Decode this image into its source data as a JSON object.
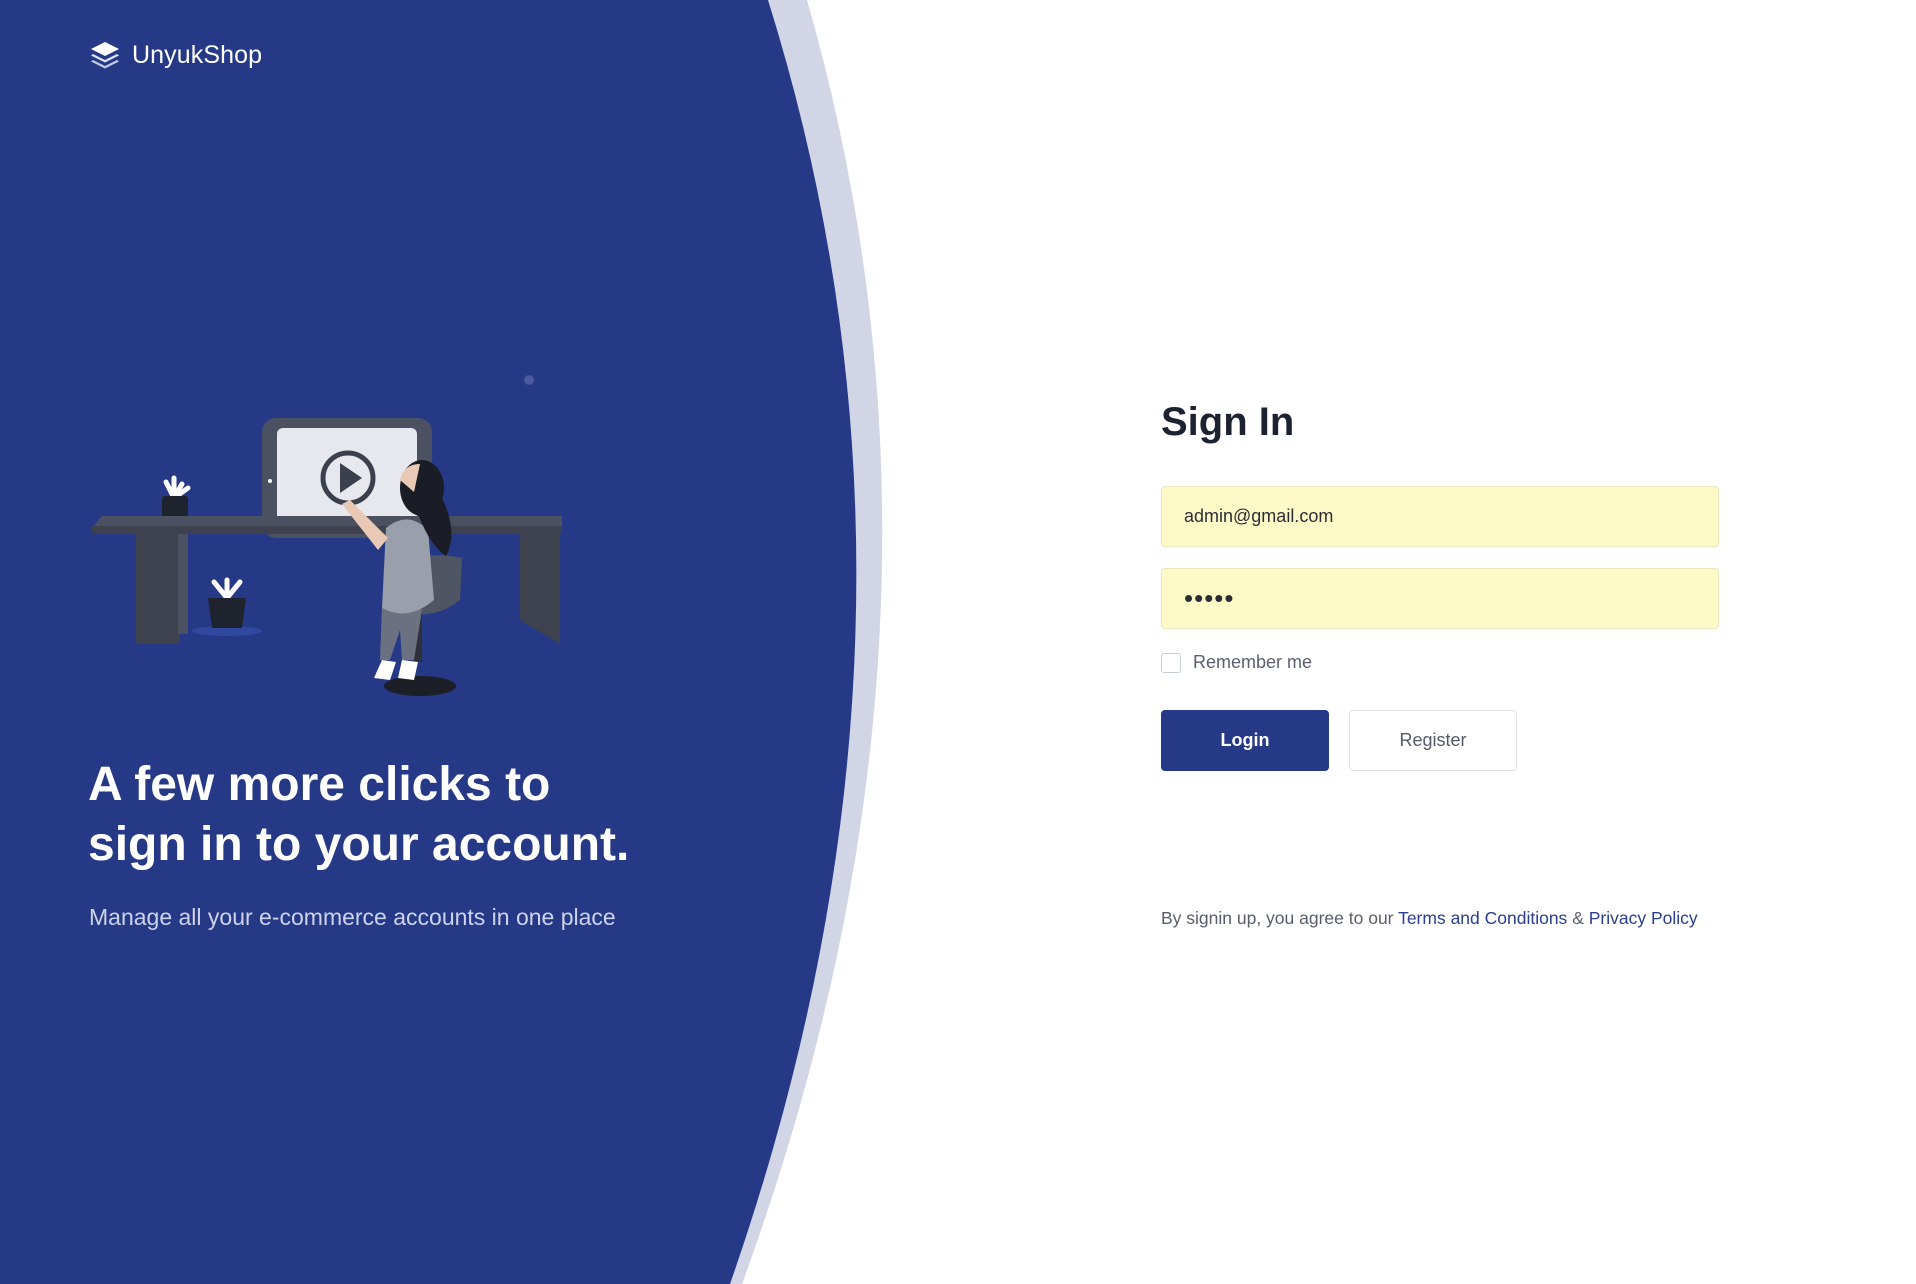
{
  "brand": {
    "name": "UnyukShop",
    "primary_color": "#263987",
    "accent_light": "#d1d5e6"
  },
  "hero": {
    "headline_line1": "A few more clicks to",
    "headline_line2": "sign in to your account.",
    "subtext": "Manage all your e-commerce accounts in one place",
    "illustration": "woman-at-desk-video-illustration"
  },
  "form": {
    "title": "Sign In",
    "email_value": "admin@gmail.com",
    "password_value": "•••••",
    "remember_label": "Remember me",
    "remember_checked": false,
    "login_label": "Login",
    "register_label": "Register"
  },
  "legal": {
    "prefix": "By signin up, you agree to our",
    "terms_label": "Terms and Conditions",
    "separator": "&",
    "privacy_label": "Privacy Policy"
  }
}
